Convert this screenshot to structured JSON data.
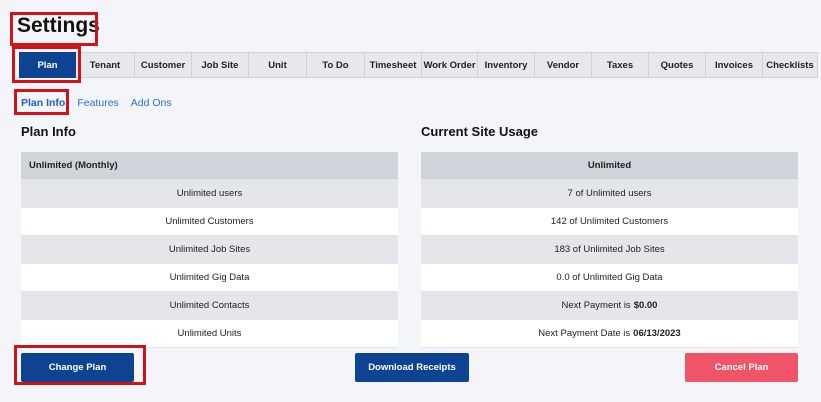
{
  "page_title": "Settings",
  "tabs": [
    {
      "label": "Plan",
      "active": true
    },
    {
      "label": "Tenant"
    },
    {
      "label": "Customer"
    },
    {
      "label": "Job Site"
    },
    {
      "label": "Unit"
    },
    {
      "label": "To Do"
    },
    {
      "label": "Timesheet"
    },
    {
      "label": "Work Order"
    },
    {
      "label": "Inventory"
    },
    {
      "label": "Vendor"
    },
    {
      "label": "Taxes"
    },
    {
      "label": "Quotes"
    },
    {
      "label": "Invoices"
    },
    {
      "label": "Checklists"
    }
  ],
  "subtabs": [
    {
      "label": "Plan Info",
      "active": true
    },
    {
      "label": "Features"
    },
    {
      "label": "Add Ons"
    }
  ],
  "plan_info": {
    "heading": "Plan Info",
    "plan_name": "Unlimited (Monthly)",
    "rows": [
      "Unlimited users",
      "Unlimited Customers",
      "Unlimited Job Sites",
      "Unlimited Gig Data",
      "Unlimited Contacts",
      "Unlimited Units"
    ]
  },
  "site_usage": {
    "heading": "Current Site Usage",
    "plan_name": "Unlimited",
    "rows": [
      "7 of Unlimited users",
      "142 of Unlimited Customers",
      "183 of Unlimited Job Sites",
      "0.0 of Unlimited Gig Data"
    ],
    "next_payment_label": "Next Payment is",
    "next_payment_value": "$0.00",
    "next_payment_date_label": "Next Payment Date is",
    "next_payment_date_value": "06/13/2023"
  },
  "buttons": {
    "change_plan": "Change Plan",
    "download_receipts": "Download Receipts",
    "cancel_plan": "Cancel Plan"
  },
  "colors": {
    "primary": "#0d4391",
    "danger": "#f05468",
    "highlight_box": "#d0121b",
    "link": "#2c6ed1"
  }
}
